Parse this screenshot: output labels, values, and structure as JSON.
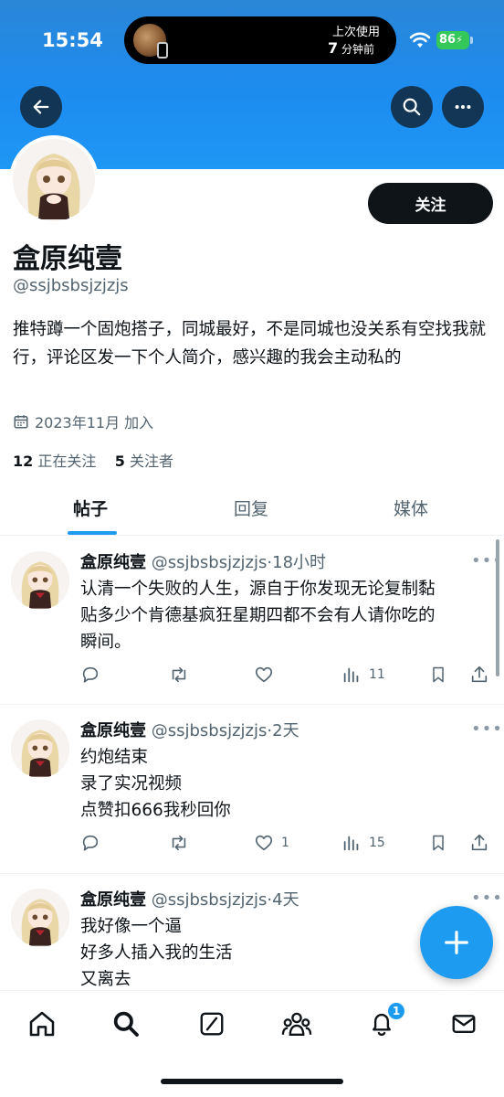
{
  "status_bar": {
    "time": "15:54",
    "island_label_top": "上次使用",
    "island_label_num": "7",
    "island_label_unit": "分钟前",
    "battery": "86"
  },
  "header": {
    "back_icon": "arrow-left-icon",
    "search_icon": "search-icon",
    "more_icon": "more-horizontal-icon"
  },
  "profile": {
    "follow_label": "关注",
    "name": "盒原纯壹",
    "handle": "@ssjbsbsjzjzjs",
    "bio": "推特蹲一个固炮搭子，同城最好，不是同城也没关系有空找我就行，评论区发一下个人简介，感兴趣的我会主动私的",
    "joined": "2023年11月 加入",
    "following_count": "12",
    "following_label": "正在关注",
    "followers_count": "5",
    "followers_label": "关注者"
  },
  "tabs": [
    "帖子",
    "回复",
    "媒体"
  ],
  "posts": [
    {
      "name": "盒原纯壹",
      "handle": "@ssjbsbsjzjzjs",
      "time": "·18小时",
      "lines": [
        "认清一个失败的人生，源自于你发现无论复制黏",
        "贴多少个肯德基疯狂星期四都不会有人请你吃的",
        "瞬间。"
      ],
      "likes": "",
      "views": "11"
    },
    {
      "name": "盒原纯壹",
      "handle": "@ssjbsbsjzjzjs",
      "time": "·2天",
      "lines": [
        "约炮结束",
        "录了实况视频",
        "点赞扣666我秒回你"
      ],
      "likes": "1",
      "views": "15"
    },
    {
      "name": "盒原纯壹",
      "handle": "@ssjbsbsjzjzjs",
      "time": "·4天",
      "lines": [
        "我好像一个逼",
        "好多人插入我的生活",
        "又离去"
      ],
      "likes": "",
      "views": ""
    }
  ],
  "nav": {
    "notification_badge": "1"
  },
  "colors": {
    "accent": "#1d9bf0",
    "banner": "#1d8cf0",
    "text": "#0f1419",
    "secondary": "#536471"
  }
}
